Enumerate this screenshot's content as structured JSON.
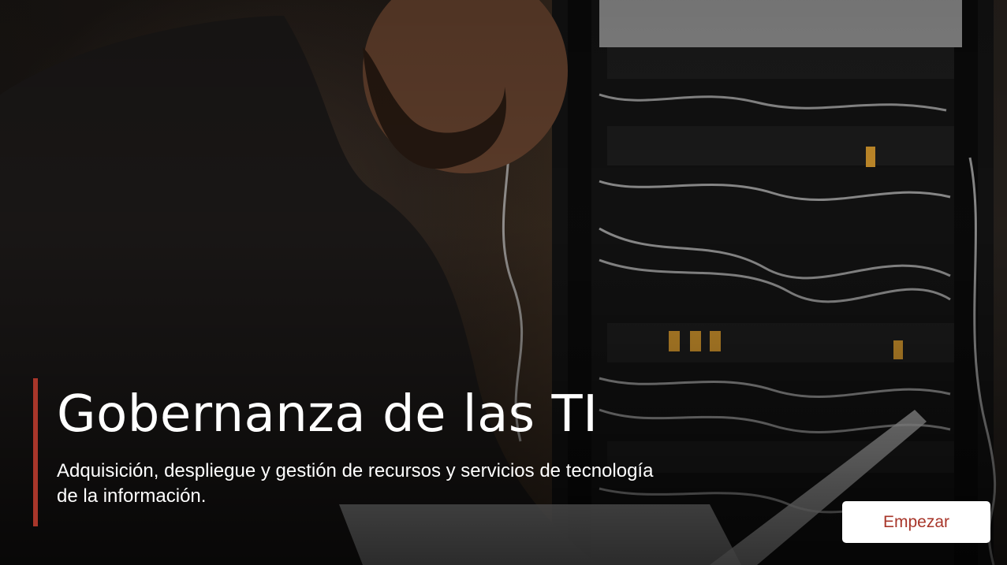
{
  "hero": {
    "title": "Gobernanza de las TI",
    "subtitle": "Adquisición, despliegue y gestión de recursos y servicios de tecnología de la información.",
    "background_image": "photo-man-working-at-server-rack"
  },
  "actions": {
    "start_label": "Empezar"
  },
  "colors": {
    "accent": "#a8362a",
    "button_bg": "#ffffff",
    "button_text": "#a8362a",
    "text": "#ffffff"
  }
}
